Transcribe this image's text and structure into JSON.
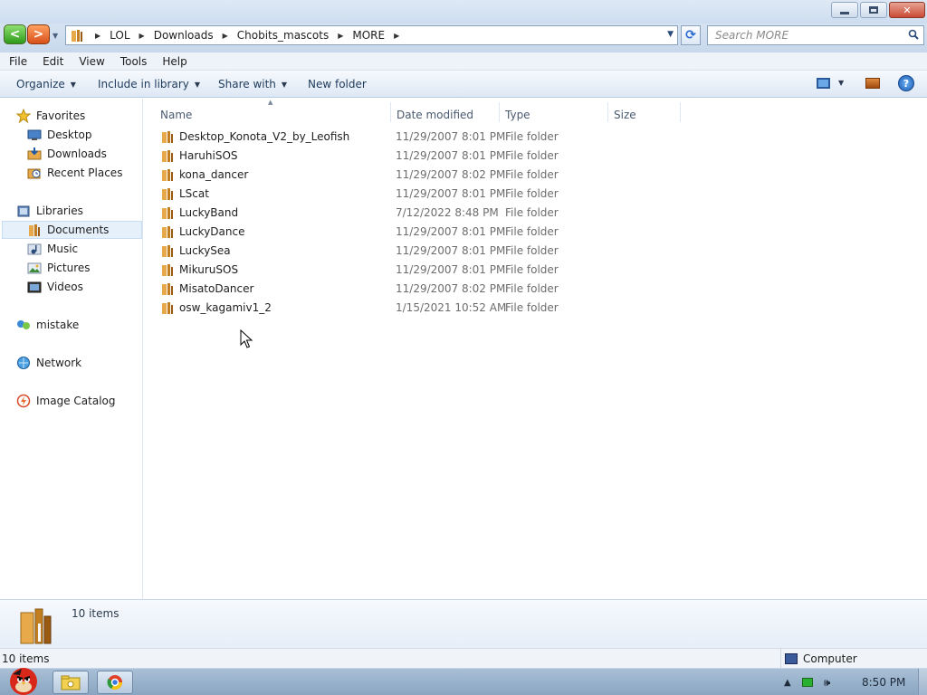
{
  "window": {
    "buttons": {
      "minimize": "minimize",
      "maximize": "maximize",
      "close": "close"
    }
  },
  "address": {
    "breadcrumbs": [
      "LOL",
      "Downloads",
      "Chobits_mascots",
      "MORE"
    ]
  },
  "search": {
    "placeholder": "Search MORE"
  },
  "menu": [
    "File",
    "Edit",
    "View",
    "Tools",
    "Help"
  ],
  "commands": {
    "organize": "Organize",
    "include_in_library": "Include in library",
    "share_with": "Share with",
    "new_folder": "New folder"
  },
  "nav": {
    "favorites": {
      "label": "Favorites",
      "items": [
        "Desktop",
        "Downloads",
        "Recent Places"
      ]
    },
    "libraries": {
      "label": "Libraries",
      "items": [
        "Documents",
        "Music",
        "Pictures",
        "Videos"
      ],
      "selected": "Documents"
    },
    "homegroup": "mistake",
    "network": "Network",
    "catalog": "Image Catalog"
  },
  "columns": {
    "name": "Name",
    "date": "Date modified",
    "type": "Type",
    "size": "Size"
  },
  "files": [
    {
      "name": "Desktop_Konota_V2_by_Leofish",
      "date": "11/29/2007 8:01 PM",
      "type": "File folder"
    },
    {
      "name": "HaruhiSOS",
      "date": "11/29/2007 8:01 PM",
      "type": "File folder"
    },
    {
      "name": "kona_dancer",
      "date": "11/29/2007 8:02 PM",
      "type": "File folder"
    },
    {
      "name": "LScat",
      "date": "11/29/2007 8:01 PM",
      "type": "File folder"
    },
    {
      "name": "LuckyBand",
      "date": "7/12/2022 8:48 PM",
      "type": "File folder"
    },
    {
      "name": "LuckyDance",
      "date": "11/29/2007 8:01 PM",
      "type": "File folder"
    },
    {
      "name": "LuckySea",
      "date": "11/29/2007 8:01 PM",
      "type": "File folder"
    },
    {
      "name": "MikuruSOS",
      "date": "11/29/2007 8:01 PM",
      "type": "File folder"
    },
    {
      "name": "MisatoDancer",
      "date": "11/29/2007 8:02 PM",
      "type": "File folder"
    },
    {
      "name": "osw_kagamiv1_2",
      "date": "1/15/2021 10:52 AM",
      "type": "File folder"
    }
  ],
  "details": {
    "count": "10 items"
  },
  "status": {
    "left": "10 items",
    "right": "Computer"
  },
  "taskbar": {
    "clock": "8:50 PM"
  },
  "colors": {
    "accent": "#2a6ad0",
    "selection": "#e5f0fb",
    "folder": "#e8a94a"
  }
}
